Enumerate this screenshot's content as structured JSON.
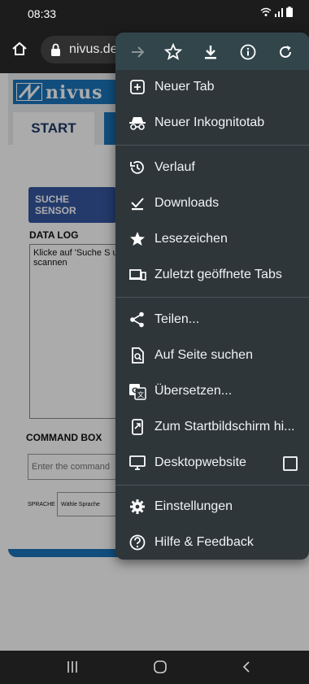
{
  "status": {
    "time": "08:33"
  },
  "browser": {
    "url": "nivus.de"
  },
  "page": {
    "tab_start": "START",
    "search_button": "SUCHE SENSOR",
    "datalog_title": "DATA LOG",
    "datalog_text": "Klicke auf 'Suche S um zu scannen",
    "command_title": "COMMAND BOX",
    "command_placeholder": "Enter the command",
    "language_label": "SPRACHE",
    "language_select": "Wähle Sprache"
  },
  "menu": {
    "toolbar": [
      "forward-icon",
      "star-icon",
      "download-icon",
      "info-icon",
      "refresh-icon"
    ],
    "items": [
      {
        "label": "Neuer Tab",
        "icon": "new-tab-icon"
      },
      {
        "label": "Neuer Inkognitotab",
        "icon": "incognito-icon"
      },
      {
        "label": "Verlauf",
        "icon": "history-icon"
      },
      {
        "label": "Downloads",
        "icon": "downloads-icon"
      },
      {
        "label": "Lesezeichen",
        "icon": "bookmarks-icon"
      },
      {
        "label": "Zuletzt geöffnete Tabs",
        "icon": "recent-tabs-icon"
      },
      {
        "label": "Teilen...",
        "icon": "share-icon"
      },
      {
        "label": "Auf Seite suchen",
        "icon": "find-in-page-icon"
      },
      {
        "label": "Übersetzen...",
        "icon": "translate-icon"
      },
      {
        "label": "Zum Startbildschirm hi...",
        "icon": "add-to-home-icon"
      },
      {
        "label": "Desktopwebsite",
        "icon": "desktop-icon",
        "checked": false
      },
      {
        "label": "Einstellungen",
        "icon": "settings-icon"
      },
      {
        "label": "Hilfe & Feedback",
        "icon": "help-icon"
      }
    ]
  },
  "colors": {
    "menu_bg": "#2e363a",
    "toolbar_bg": "#31454b",
    "brand_blue": "#1a75bc",
    "button_blue": "#3557a0"
  }
}
